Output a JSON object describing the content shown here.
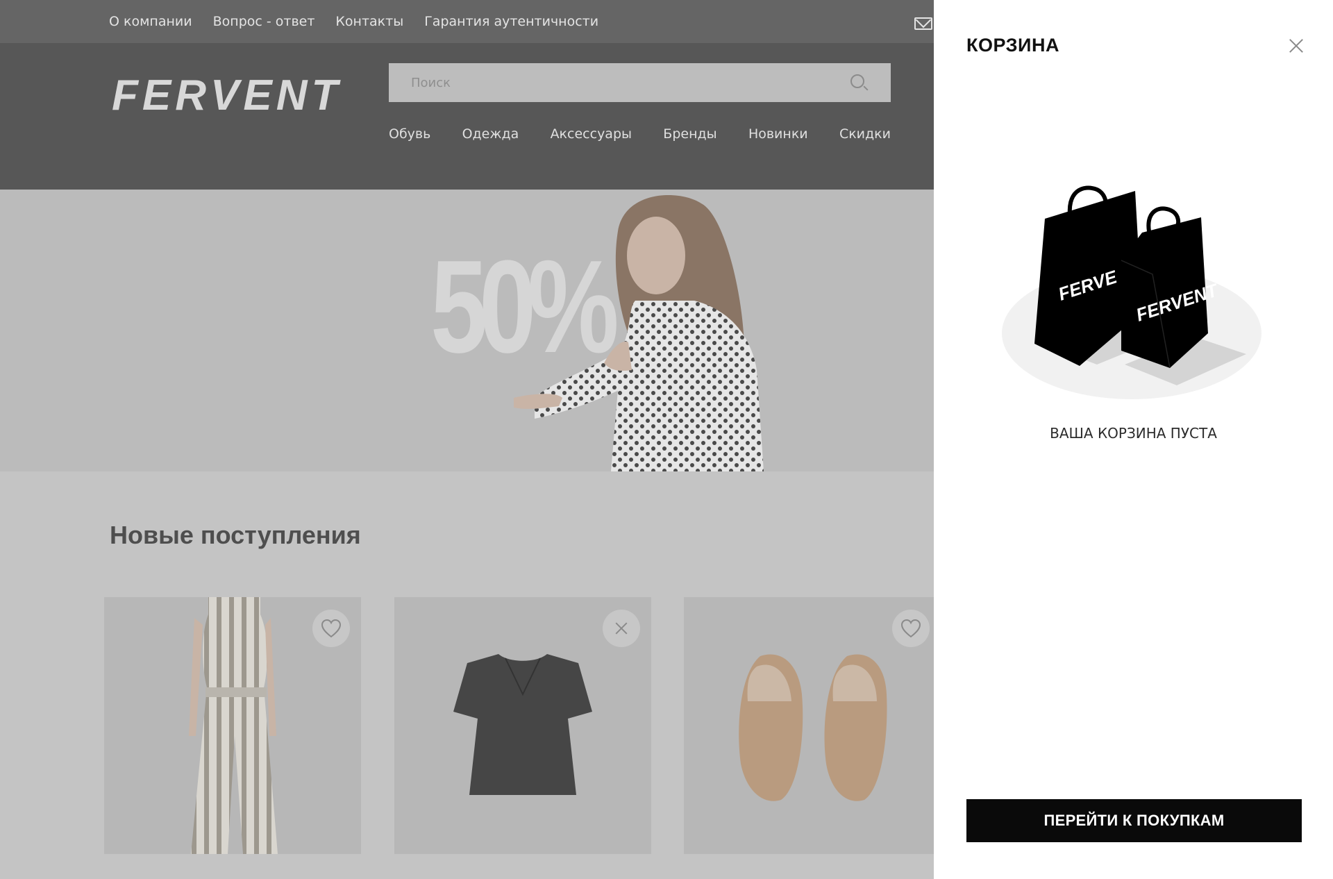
{
  "topbar": {
    "links": [
      "О компании",
      "Вопрос - ответ",
      "Контакты",
      "Гарантия аутентичности"
    ]
  },
  "header": {
    "logo": "FERVENT",
    "search_placeholder": "Поиск",
    "categories": [
      "Обувь",
      "Одежда",
      "Аксессуары",
      "Бренды",
      "Новинки",
      "Скидки"
    ]
  },
  "banner": {
    "text": "50%"
  },
  "main": {
    "section_title": "Новые поступления",
    "products": [
      {
        "image": "striped-jumpsuit",
        "action_icon": "heart-icon"
      },
      {
        "image": "dark-blouse",
        "action_icon": "close-icon"
      },
      {
        "image": "beige-loafers",
        "action_icon": "heart-icon"
      }
    ]
  },
  "cart": {
    "title": "КОРЗИНА",
    "empty_message": "ВАША КОРЗИНА ПУСТА",
    "bag_brand": "FERVENT",
    "shop_button": "ПЕРЕЙТИ К ПОКУПКАМ"
  },
  "colors": {
    "overlay_gray": "#c4c4c4",
    "header_gray": "#575757",
    "button_black": "#0a0a0a"
  }
}
